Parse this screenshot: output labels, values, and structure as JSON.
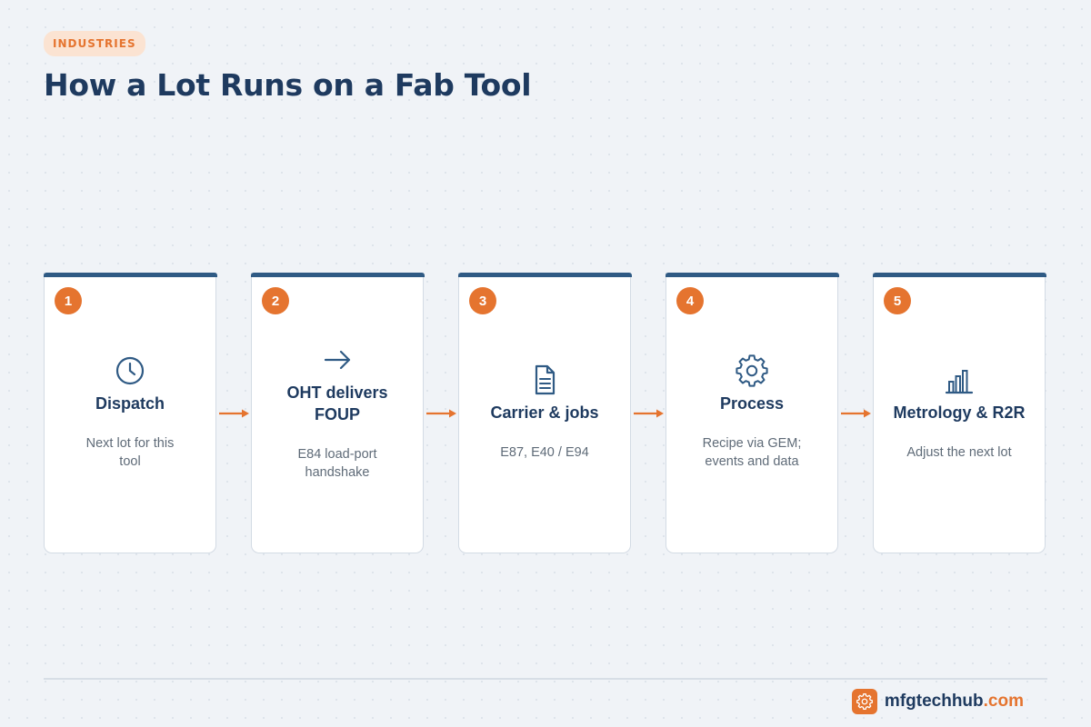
{
  "header": {
    "tag": "INDUSTRIES",
    "title": "How a Lot Runs on a Fab Tool"
  },
  "steps": [
    {
      "number": "1",
      "icon": "clock-icon",
      "title": "Dispatch",
      "desc": "Next lot for this tool"
    },
    {
      "number": "2",
      "icon": "arrow-right-icon",
      "title": "OHT delivers FOUP",
      "desc": "E84 load-port handshake"
    },
    {
      "number": "3",
      "icon": "document-icon",
      "title": "Carrier & jobs",
      "desc": "E87, E40 / E94"
    },
    {
      "number": "4",
      "icon": "gear-icon",
      "title": "Process",
      "desc": "Recipe via GEM; events and data"
    },
    {
      "number": "5",
      "icon": "bar-chart-icon",
      "title": "Metrology & R2R",
      "desc": "Adjust the next lot"
    }
  ],
  "footer": {
    "brand_name": "mfgtechhub",
    "brand_tld": ".com",
    "logo_icon": "gear-icon"
  },
  "colors": {
    "accent": "#e5742f",
    "navy": "#1e3a5f",
    "card_bar": "#2f5a84",
    "background": "#f0f3f7"
  }
}
